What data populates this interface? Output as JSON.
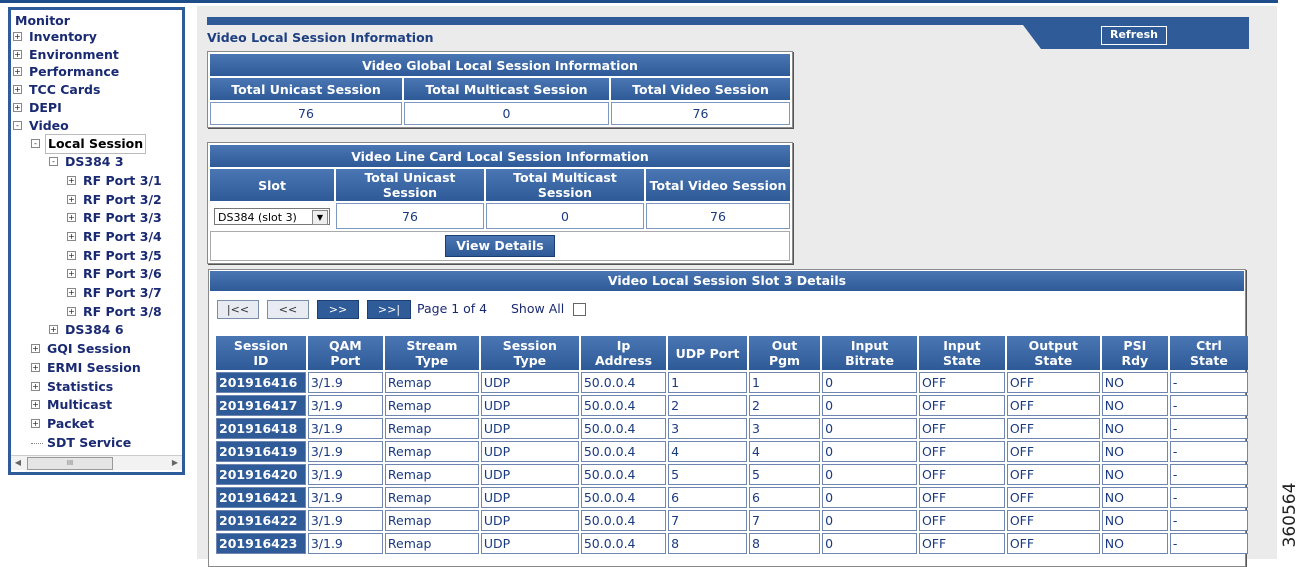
{
  "tree": {
    "root": "Monitor",
    "nodes": [
      {
        "label": "Inventory",
        "box": "+"
      },
      {
        "label": "Environment",
        "box": "+"
      },
      {
        "label": "Performance",
        "box": "+"
      },
      {
        "label": "TCC Cards",
        "box": "+"
      },
      {
        "label": "DEPI",
        "box": "+"
      },
      {
        "label": "Video",
        "box": "−"
      },
      {
        "label": "Local Session",
        "box": "−"
      },
      {
        "label": "DS384 3",
        "box": "−"
      },
      {
        "label": "RF Port 3/1",
        "box": "+"
      },
      {
        "label": "RF Port 3/2",
        "box": "+"
      },
      {
        "label": "RF Port 3/3",
        "box": "+"
      },
      {
        "label": "RF Port 3/4",
        "box": "+"
      },
      {
        "label": "RF Port 3/5",
        "box": "+"
      },
      {
        "label": "RF Port 3/6",
        "box": "+"
      },
      {
        "label": "RF Port 3/7",
        "box": "+"
      },
      {
        "label": "RF Port 3/8",
        "box": "+"
      },
      {
        "label": "DS384 6",
        "box": "+"
      },
      {
        "label": "GQI Session",
        "box": "+"
      },
      {
        "label": "ERMI Session",
        "box": "+"
      },
      {
        "label": "Statistics",
        "box": "+"
      },
      {
        "label": "Multicast",
        "box": "+"
      },
      {
        "label": "Packet",
        "box": "+"
      },
      {
        "label": "SDT Service",
        "box": ""
      }
    ],
    "scroll_thumb": "III"
  },
  "header": {
    "title": "Video Local Session Information",
    "refresh_label": "Refresh"
  },
  "global_panel": {
    "title": "Video Global Local Session Information",
    "columns": [
      "Total Unicast Session",
      "Total Multicast Session",
      "Total Video Session"
    ],
    "values": [
      "76",
      "0",
      "76"
    ]
  },
  "linecard_panel": {
    "title": "Video Line Card Local Session Information",
    "columns": [
      "Slot",
      "Total Unicast Session",
      "Total Multicast Session",
      "Total Video Session"
    ],
    "slot_selected": "DS384 (slot 3)",
    "values": [
      "76",
      "0",
      "76"
    ],
    "view_details_label": "View Details"
  },
  "slot_panel": {
    "title": "Video Local Session Slot 3 Details",
    "nav": {
      "first": "|<<",
      "prev": "<<",
      "next": ">>",
      "last": ">>|"
    },
    "page_info": "Page 1 of 4",
    "show_all_label": "Show All",
    "columns": [
      [
        "Session",
        "ID"
      ],
      [
        "QAM",
        "Port"
      ],
      [
        "Stream",
        "Type"
      ],
      [
        "Session",
        "Type"
      ],
      [
        "Ip",
        "Address"
      ],
      [
        "UDP Port",
        ""
      ],
      [
        "Out",
        "Pgm"
      ],
      [
        "Input",
        "Bitrate"
      ],
      [
        "Input",
        "State"
      ],
      [
        "Output",
        "State"
      ],
      [
        "PSI",
        "Rdy"
      ],
      [
        "Ctrl",
        "State"
      ]
    ],
    "rows": [
      [
        "201916416",
        "3/1.9",
        "Remap",
        "UDP",
        "50.0.0.4",
        "1",
        "1",
        "0",
        "OFF",
        "OFF",
        "NO",
        "-"
      ],
      [
        "201916417",
        "3/1.9",
        "Remap",
        "UDP",
        "50.0.0.4",
        "2",
        "2",
        "0",
        "OFF",
        "OFF",
        "NO",
        "-"
      ],
      [
        "201916418",
        "3/1.9",
        "Remap",
        "UDP",
        "50.0.0.4",
        "3",
        "3",
        "0",
        "OFF",
        "OFF",
        "NO",
        "-"
      ],
      [
        "201916419",
        "3/1.9",
        "Remap",
        "UDP",
        "50.0.0.4",
        "4",
        "4",
        "0",
        "OFF",
        "OFF",
        "NO",
        "-"
      ],
      [
        "201916420",
        "3/1.9",
        "Remap",
        "UDP",
        "50.0.0.4",
        "5",
        "5",
        "0",
        "OFF",
        "OFF",
        "NO",
        "-"
      ],
      [
        "201916421",
        "3/1.9",
        "Remap",
        "UDP",
        "50.0.0.4",
        "6",
        "6",
        "0",
        "OFF",
        "OFF",
        "NO",
        "-"
      ],
      [
        "201916422",
        "3/1.9",
        "Remap",
        "UDP",
        "50.0.0.4",
        "7",
        "7",
        "0",
        "OFF",
        "OFF",
        "NO",
        "-"
      ],
      [
        "201916423",
        "3/1.9",
        "Remap",
        "UDP",
        "50.0.0.4",
        "8",
        "8",
        "0",
        "OFF",
        "OFF",
        "NO",
        "-"
      ]
    ]
  },
  "figure_number": "360564",
  "colors": {
    "accent": "#2f5b98",
    "tree_text": "#1a2a72"
  }
}
